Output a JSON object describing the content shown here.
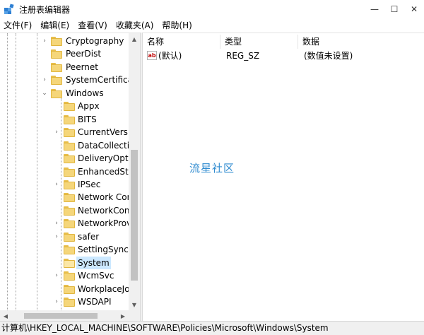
{
  "window": {
    "title": "注册表编辑器",
    "minimize_glyph": "—",
    "maximize_glyph": "☐",
    "close_glyph": "✕"
  },
  "menu": [
    "文件(F)",
    "编辑(E)",
    "查看(V)",
    "收藏夹(A)",
    "帮助(H)"
  ],
  "tree": {
    "items": [
      {
        "label": "Cryptography",
        "depth": 1,
        "expander": "›"
      },
      {
        "label": "PeerDist",
        "depth": 1,
        "expander": ""
      },
      {
        "label": "Peernet",
        "depth": 1,
        "expander": ""
      },
      {
        "label": "SystemCertificate",
        "depth": 1,
        "expander": "›"
      },
      {
        "label": "Windows",
        "depth": 1,
        "expander": "⌄"
      },
      {
        "label": "Appx",
        "depth": 2,
        "expander": ""
      },
      {
        "label": "BITS",
        "depth": 2,
        "expander": ""
      },
      {
        "label": "CurrentVersic",
        "depth": 2,
        "expander": "›"
      },
      {
        "label": "DataCollectio",
        "depth": 2,
        "expander": ""
      },
      {
        "label": "DeliveryOptin",
        "depth": 2,
        "expander": ""
      },
      {
        "label": "EnhancedStor",
        "depth": 2,
        "expander": ""
      },
      {
        "label": "IPSec",
        "depth": 2,
        "expander": "›"
      },
      {
        "label": "Network Con",
        "depth": 2,
        "expander": ""
      },
      {
        "label": "NetworkConr",
        "depth": 2,
        "expander": ""
      },
      {
        "label": "NetworkProv",
        "depth": 2,
        "expander": "›"
      },
      {
        "label": "safer",
        "depth": 2,
        "expander": "›"
      },
      {
        "label": "SettingSync",
        "depth": 2,
        "expander": ""
      },
      {
        "label": "System",
        "depth": 2,
        "expander": "",
        "selected": true
      },
      {
        "label": "WcmSvc",
        "depth": 2,
        "expander": "›"
      },
      {
        "label": "WorkplaceJo",
        "depth": 2,
        "expander": ""
      },
      {
        "label": "WSDAPI",
        "depth": 2,
        "expander": "›"
      }
    ]
  },
  "values": {
    "columns": [
      "名称",
      "类型",
      "数据"
    ],
    "rows": [
      {
        "name": "(默认)",
        "type": "REG_SZ",
        "data": "(数值未设置)",
        "icon": "string-value-icon"
      }
    ]
  },
  "watermark": "流星社区",
  "status": {
    "path": "计算机\\HKEY_LOCAL_MACHINE\\SOFTWARE\\Policies\\Microsoft\\Windows\\System"
  }
}
